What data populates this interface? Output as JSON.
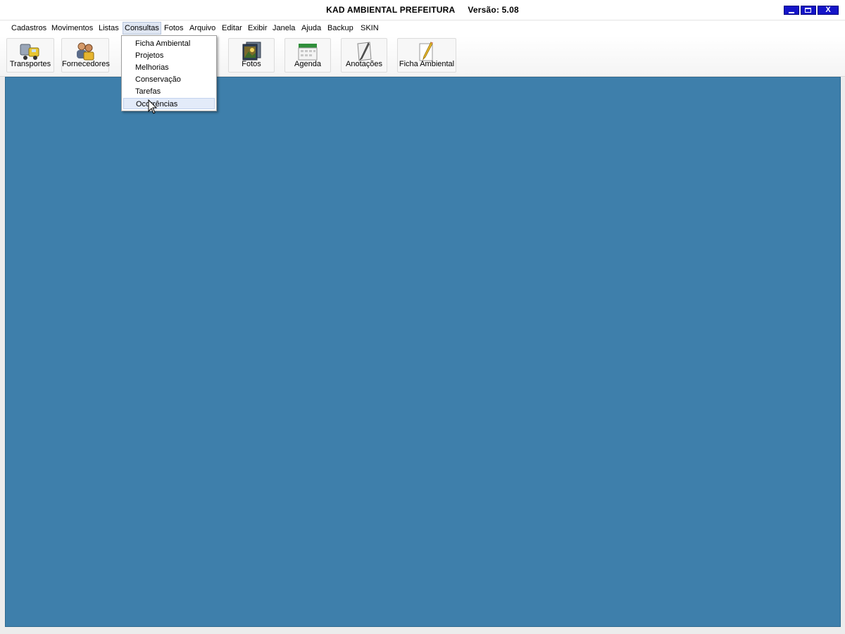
{
  "window": {
    "title": "KAD AMBIENTAL PREFEITURA",
    "version": "Versão: 5.08",
    "controls": {
      "minimize": "minimize",
      "maximize": "maximize",
      "close": "X"
    }
  },
  "menubar": {
    "items": [
      {
        "label": "Cadastros"
      },
      {
        "label": "Movimentos"
      },
      {
        "label": "Listas"
      },
      {
        "label": "Consultas",
        "active": true
      },
      {
        "label": "Fotos"
      },
      {
        "label": "Arquivo"
      },
      {
        "label": "Editar"
      },
      {
        "label": "Exibir"
      },
      {
        "label": "Janela"
      },
      {
        "label": "Ajuda"
      },
      {
        "label": "Backup"
      },
      {
        "label": "SKIN"
      }
    ]
  },
  "toolbar": {
    "buttons": [
      {
        "label": "Transportes",
        "icon": "truck-icon"
      },
      {
        "label": "Fornecedores",
        "icon": "people-icon"
      },
      {
        "label": "Fotos",
        "icon": "photos-icon"
      },
      {
        "label": "Agenda",
        "icon": "calendar-icon"
      },
      {
        "label": "Anotações",
        "icon": "notes-icon"
      },
      {
        "label": "Ficha Ambiental",
        "icon": "pencil-paper-icon"
      }
    ]
  },
  "consultas_menu": {
    "items": [
      {
        "label": "Ficha Ambiental"
      },
      {
        "label": "Projetos"
      },
      {
        "label": "Melhorias"
      },
      {
        "label": "Conservação"
      },
      {
        "label": "Tarefas"
      },
      {
        "label": "Ocorrências",
        "hovered": true
      }
    ]
  },
  "colors": {
    "mdi_background": "#3e7fab",
    "window_button": "#1414c8"
  }
}
